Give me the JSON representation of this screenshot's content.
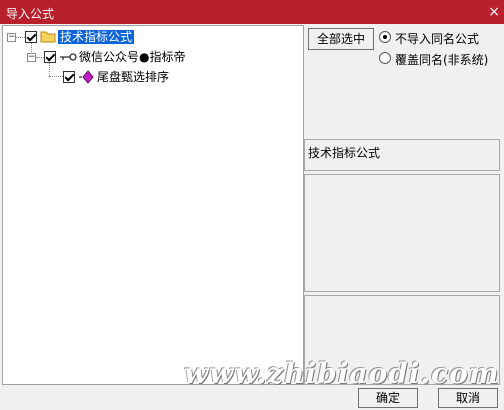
{
  "window": {
    "title": "导入公式",
    "close_glyph": "×"
  },
  "tree": {
    "root": {
      "label": "技术指标公式"
    },
    "child": {
      "label": "微信公众号●指标帝",
      "icon": "key-icon"
    },
    "leaf": {
      "label": "尾盘甄选排序",
      "icon": "formula-diamond-icon"
    }
  },
  "controls": {
    "select_all_label": "全部选中",
    "option_skip_label": "不导入同名公式",
    "option_overwrite_label": "覆盖同名(非系统)",
    "selected_option": "option_skip"
  },
  "info": {
    "category_text": "技术指标公式"
  },
  "buttons": {
    "ok_label": "确定",
    "cancel_label": "取消"
  },
  "watermark": {
    "text": "www.zhibiaodi.com"
  },
  "colors": {
    "titlebar": "#b8202c",
    "selection": "#0a64d8"
  }
}
